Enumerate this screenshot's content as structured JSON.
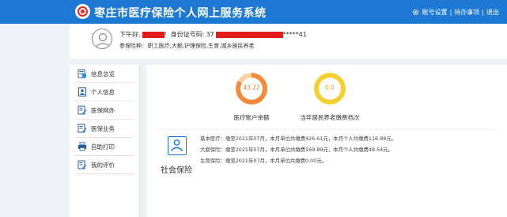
{
  "header": {
    "title": "枣庄市医疗保险个人网上服务系统",
    "links": [
      "账号设置",
      "待办事项",
      "退出"
    ],
    "sep": "|"
  },
  "user": {
    "greeting": "下午好,",
    "greeting_suffix": "!",
    "id_label": "身份证号码:",
    "id_prefix": "37",
    "id_suffix": "*****41",
    "insurance_label": "参保险种:",
    "insurance_types": "职工医疗,大额,护理保险,生育,城乡居民养老"
  },
  "sidebar": {
    "items": [
      {
        "label": "信息总览",
        "icon": "overview-icon"
      },
      {
        "label": "个人信息",
        "icon": "person-icon"
      },
      {
        "label": "医保网办",
        "icon": "edit-doc-icon"
      },
      {
        "label": "医保业务",
        "icon": "edit-doc-icon"
      },
      {
        "label": "自助打印",
        "icon": "printer-icon"
      },
      {
        "label": "我的评价",
        "icon": "review-icon"
      }
    ]
  },
  "stats": {
    "account_balance": {
      "value": "43.22",
      "label": "医疗账户余额",
      "color": "#f08a3c"
    },
    "pension_tier": {
      "value": "0.0",
      "label": "当年居民养老缴费档次",
      "color": "#f3cf31"
    }
  },
  "social_insurance": {
    "label": "社会保险",
    "rows": [
      "基本医疗：缴至2021年07月，本月单位共缴费426.61元，本月个人共缴费116.88元。",
      "大额保险：缴至2021年07月，本月单位共缴费169.89元，本月个人共缴费48.54元。",
      "生育保险：缴至2021年07月，本月单位共缴费0.00元。"
    ]
  },
  "colors": {
    "header_blue": "#1d79d3",
    "redaction": "#e21c1c"
  }
}
